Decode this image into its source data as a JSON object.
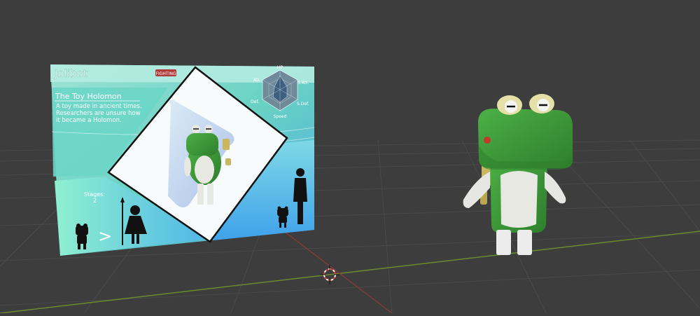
{
  "viewport": {
    "background": "#3d3d3d",
    "grid_color": "#4a4a4a",
    "x_axis_color": "#8a3b3b",
    "y_axis_color": "#6b8a2f"
  },
  "card": {
    "title": "Jolibot",
    "type_badge": "FIGHTING",
    "subtitle": "The Toy Holomon",
    "description": [
      "A toy made in ancient times.",
      "Researchers are unsure how",
      "it became a Holomon."
    ],
    "stages_label": "Stages:",
    "stages_value": "2",
    "stage_arrow": ">",
    "stats": {
      "top": "HP",
      "top_left": "Att.",
      "top_right": "S.Att.",
      "bottom_left": "Def.",
      "bottom_right": "S.Def.",
      "bottom": "Speed"
    },
    "colors": {
      "teal": "#5fd3c3",
      "blue": "#4aa3e8",
      "mint": "#8ee6cf",
      "header": "#9fe3d6"
    }
  },
  "model": {
    "name": "frog-robot",
    "body_color": "#3f9e3a",
    "belly_color": "#e8e8e2",
    "key_color": "#c9b760"
  }
}
